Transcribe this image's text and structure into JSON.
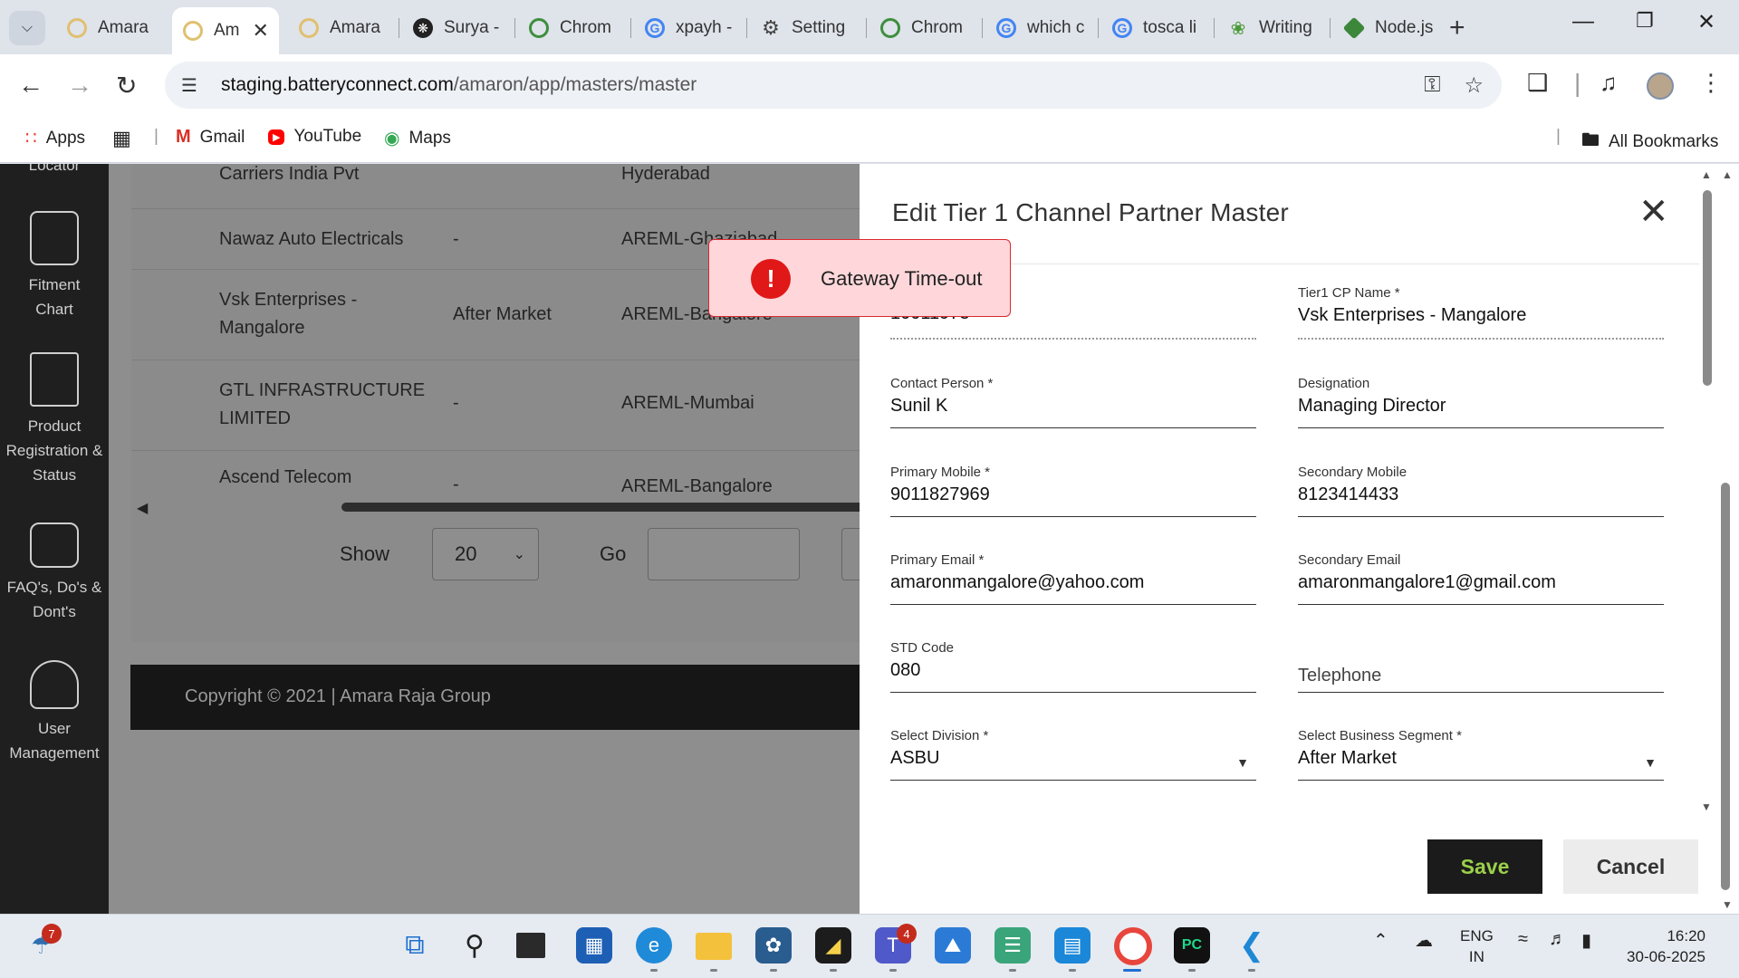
{
  "browser": {
    "tabs": [
      {
        "label": "Amara",
        "favicon": "amaron-icon",
        "color": "#e0c070"
      },
      {
        "label": "Am",
        "favicon": "amaron-icon",
        "color": "#e0c070",
        "active": true
      },
      {
        "label": "Amara",
        "favicon": "amaron-icon",
        "color": "#e0c070"
      },
      {
        "label": "Surya -",
        "favicon": "openai-icon",
        "color": "#222222"
      },
      {
        "label": "Chrom",
        "favicon": "chrome-web-store-icon",
        "color": "#3e8f3e"
      },
      {
        "label": "xpayh -",
        "favicon": "google-icon",
        "color": "#4285f4"
      },
      {
        "label": "Setting",
        "favicon": "gear-icon",
        "color": "#444444"
      },
      {
        "label": "Chrom",
        "favicon": "chrome-web-store-icon",
        "color": "#3e8f3e"
      },
      {
        "label": "which c",
        "favicon": "google-icon",
        "color": "#4285f4"
      },
      {
        "label": "tosca li",
        "favicon": "google-icon",
        "color": "#4285f4"
      },
      {
        "label": "Writing",
        "favicon": "leaf-icon",
        "color": "#4a9a3a"
      },
      {
        "label": "Node.js",
        "favicon": "nodejs-icon",
        "color": "#3c873a"
      }
    ],
    "url_host": "staging.batteryconnect.com",
    "url_path": "/amaron/app/masters/master",
    "bookmarks": [
      {
        "label": "Apps",
        "icon": "apps-grid-icon"
      },
      {
        "label": "",
        "icon": "grid-icon"
      },
      {
        "label": "Gmail",
        "icon": "gmail-icon"
      },
      {
        "label": "YouTube",
        "icon": "youtube-icon"
      },
      {
        "label": "Maps",
        "icon": "maps-pin-icon"
      }
    ],
    "all_bookmarks": "All Bookmarks"
  },
  "sidebar": {
    "partial_top": "Locator",
    "items": [
      {
        "label": "Fitment Chart",
        "icon": "fitment-chart-icon"
      },
      {
        "label": "Product Registration & Status",
        "icon": "product-registration-icon"
      },
      {
        "label": "FAQ's, Do's & Dont's",
        "icon": "faq-icon"
      },
      {
        "label": "User Management",
        "icon": "user-management-icon"
      }
    ]
  },
  "table": {
    "rows": [
      {
        "name": "Carriers India Pvt",
        "segment": "",
        "region": "Hyderabad"
      },
      {
        "name": "Nawaz Auto Electricals",
        "segment": "-",
        "region": "AREML-Ghaziabad"
      },
      {
        "name": "Vsk Enterprises - Mangalore",
        "segment": "After Market",
        "region": "AREML-Bangalore"
      },
      {
        "name": "GTL INFRASTRUCTURE LIMITED",
        "segment": "-",
        "region": "AREML-Mumbai"
      },
      {
        "name": "Ascend Telecom",
        "segment": "-",
        "region": "AREML-Bangalore"
      }
    ]
  },
  "pager": {
    "show_label": "Show",
    "page_size": "20",
    "go_label": "Go"
  },
  "footer": {
    "copyright": "Copyright © 2021 | Amara Raja Group"
  },
  "modal": {
    "title": "Edit Tier 1 Channel Partner  Master",
    "fields": {
      "code": {
        "label": "",
        "value": "10011973"
      },
      "cp_name": {
        "label": "Tier1 CP Name *",
        "value": "Vsk Enterprises - Mangalore"
      },
      "contact_person": {
        "label": "Contact Person *",
        "value": "Sunil K"
      },
      "designation": {
        "label": "Designation",
        "value": "Managing Director"
      },
      "primary_mobile": {
        "label": "Primary Mobile *",
        "value": "9011827969"
      },
      "secondary_mobile": {
        "label": "Secondary Mobile",
        "value": "8123414433"
      },
      "primary_email": {
        "label": "Primary Email *",
        "value": "amaronmangalore@yahoo.com"
      },
      "secondary_email": {
        "label": "Secondary Email",
        "value": "amaronmangalore1@gmail.com"
      },
      "std_code": {
        "label": "STD Code",
        "value": "080"
      },
      "telephone": {
        "placeholder": "Telephone"
      },
      "division": {
        "label": "Select Division *",
        "value": "ASBU"
      },
      "business_segment": {
        "label": "Select Business Segment *",
        "value": "After Market"
      }
    },
    "save_label": "Save",
    "cancel_label": "Cancel"
  },
  "toast": {
    "message": "Gateway Time-out",
    "color": "#e01818"
  },
  "taskbar": {
    "weather_badge": "7",
    "teams_badge": "4",
    "lang_line1": "ENG",
    "lang_line2": "IN",
    "time": "16:20",
    "date": "30-06-2025"
  }
}
